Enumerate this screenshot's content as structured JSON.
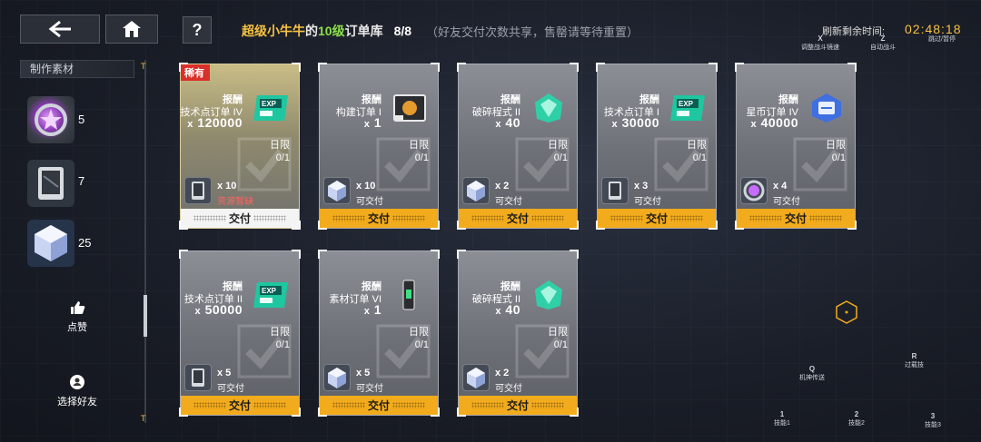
{
  "header": {
    "back_icon": "back-arrow-icon",
    "home_icon": "home-icon",
    "help_label": "?",
    "title_player": "超级小牛牛",
    "title_of": "的",
    "title_level": "10级",
    "title_suffix": "订单库",
    "title_count": "8/8",
    "title_note": "（好友交付次数共享，售罄请等待重置）",
    "refresh_label": "刷新剩余时间:",
    "refresh_time": "02:48:18"
  },
  "hotkeys": [
    {
      "key": "X",
      "label": "调整战斗镜速"
    },
    {
      "key": "Z",
      "label": "自动战斗"
    },
    {
      "key": "",
      "label": "跳过/暂停"
    },
    {
      "key": "Q",
      "label": "机神传送"
    },
    {
      "key": "R",
      "label": "过载技"
    },
    {
      "key": "1",
      "label": "技能1"
    },
    {
      "key": "2",
      "label": "技能2"
    },
    {
      "key": "3",
      "label": "技能3"
    }
  ],
  "sidebar": {
    "title": "制作素材",
    "materials": [
      {
        "icon": "purple-star-coin-icon",
        "count": "5"
      },
      {
        "icon": "dark-tablet-icon",
        "count": "7"
      },
      {
        "icon": "crystal-cube-icon",
        "count": "25"
      }
    ],
    "like_label": "点赞",
    "select_friend_label": "选择好友"
  },
  "cards": [
    {
      "rare": "稀有",
      "reward_label": "报酬",
      "order": "技术点订单 IV",
      "qty_x": "x",
      "qty": "120000",
      "item_icon": "exp-chip-icon",
      "limit_label": "日限",
      "limit": "0/1",
      "need_icon": "dark-tablet-icon",
      "need_qty": "x 10",
      "status": "资源暂缺",
      "status_warn": true,
      "deliver": "交付",
      "disabled": true
    },
    {
      "rare": "",
      "reward_label": "报酬",
      "order": "构建订单 I",
      "qty_x": "x",
      "qty": "1",
      "item_icon": "build-card-icon",
      "limit_label": "日限",
      "limit": "0/1",
      "need_icon": "crystal-cube-icon",
      "need_qty": "x 10",
      "status": "可交付",
      "status_warn": false,
      "deliver": "交付",
      "disabled": false
    },
    {
      "rare": "",
      "reward_label": "报酬",
      "order": "破碎程式 II",
      "qty_x": "x",
      "qty": "40",
      "item_icon": "green-shard-icon",
      "limit_label": "日限",
      "limit": "0/1",
      "need_icon": "crystal-cube-icon",
      "need_qty": "x 2",
      "status": "可交付",
      "status_warn": false,
      "deliver": "交付",
      "disabled": false
    },
    {
      "rare": "",
      "reward_label": "报酬",
      "order": "技术点订单 I",
      "qty_x": "x",
      "qty": "30000",
      "item_icon": "exp-chip-icon",
      "limit_label": "日限",
      "limit": "0/1",
      "need_icon": "dark-tablet-icon",
      "need_qty": "x 3",
      "status": "可交付",
      "status_warn": false,
      "deliver": "交付",
      "disabled": false
    },
    {
      "rare": "",
      "reward_label": "报酬",
      "order": "星币订单 IV",
      "qty_x": "x",
      "qty": "40000",
      "item_icon": "star-coin-icon",
      "limit_label": "日限",
      "limit": "0/1",
      "need_icon": "purple-star-coin-icon",
      "need_qty": "x 4",
      "status": "可交付",
      "status_warn": false,
      "deliver": "交付",
      "disabled": false
    },
    {
      "rare": "",
      "reward_label": "报酬",
      "order": "技术点订单 II",
      "qty_x": "x",
      "qty": "50000",
      "item_icon": "exp-chip-icon",
      "limit_label": "日限",
      "limit": "0/1",
      "need_icon": "dark-tablet-icon",
      "need_qty": "x 5",
      "status": "可交付",
      "status_warn": false,
      "deliver": "交付",
      "disabled": false
    },
    {
      "rare": "",
      "reward_label": "报酬",
      "order": "素材订单 VI",
      "qty_x": "x",
      "qty": "1",
      "item_icon": "material-device-icon",
      "limit_label": "日限",
      "limit": "0/1",
      "need_icon": "crystal-cube-icon",
      "need_qty": "x 5",
      "status": "可交付",
      "status_warn": false,
      "deliver": "交付",
      "disabled": false
    },
    {
      "rare": "",
      "reward_label": "报酬",
      "order": "破碎程式 II",
      "qty_x": "x",
      "qty": "40",
      "item_icon": "green-shard-icon",
      "limit_label": "日限",
      "limit": "0/1",
      "need_icon": "crystal-cube-icon",
      "need_qty": "x 2",
      "status": "可交付",
      "status_warn": false,
      "deliver": "交付",
      "disabled": false
    }
  ],
  "colors": {
    "accent": "#f2ab1c",
    "title_yellow": "#f6c143",
    "title_green": "#8be04a",
    "warn": "#ff6464",
    "rare_tag": "#d9302a"
  }
}
